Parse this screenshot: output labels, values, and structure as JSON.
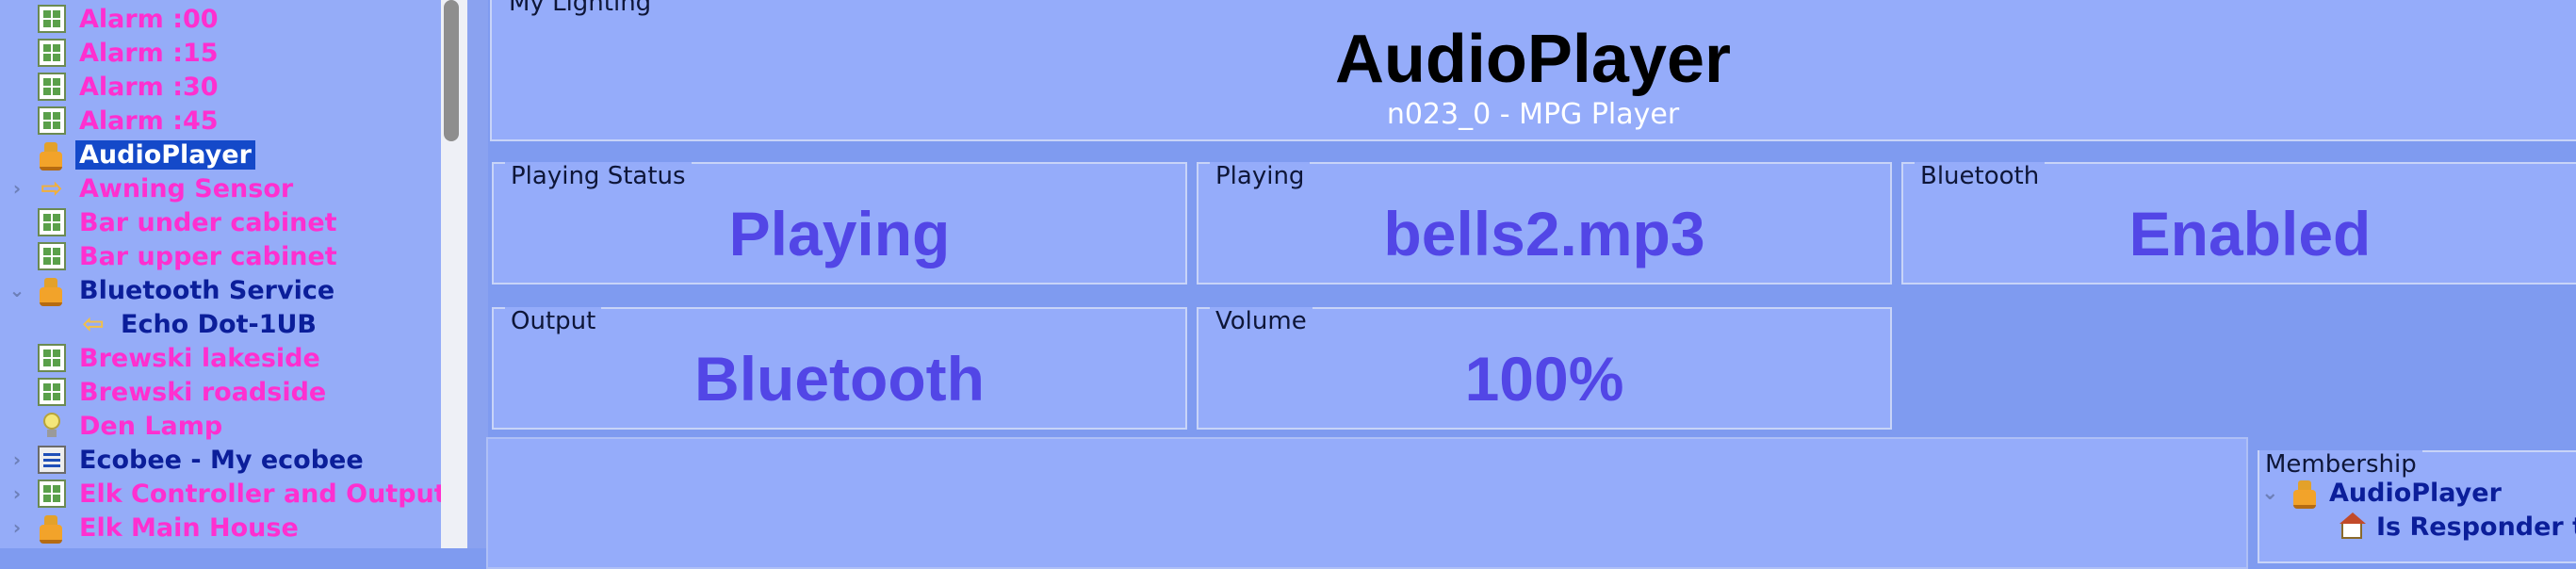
{
  "tree": {
    "items": [
      {
        "label": "Alarm :00",
        "icon": "scene-grid-icon",
        "style": "pink"
      },
      {
        "label": "Alarm :15",
        "icon": "scene-grid-icon",
        "style": "pink"
      },
      {
        "label": "Alarm :30",
        "icon": "scene-grid-icon",
        "style": "pink"
      },
      {
        "label": "Alarm :45",
        "icon": "scene-grid-icon",
        "style": "pink"
      },
      {
        "label": "AudioPlayer",
        "icon": "node-server-icon",
        "style": "selected"
      },
      {
        "label": "Awning Sensor",
        "icon": "arrow-right-icon",
        "style": "pink"
      },
      {
        "label": "Bar under cabinet",
        "icon": "scene-grid-icon",
        "style": "pink"
      },
      {
        "label": "Bar upper cabinet",
        "icon": "scene-grid-icon",
        "style": "pink"
      },
      {
        "label": "Bluetooth Service",
        "icon": "node-server-icon",
        "style": "navy"
      },
      {
        "label": "Echo Dot-1UB",
        "icon": "arrow-left-icon",
        "style": "navy"
      },
      {
        "label": "Brewski lakeside",
        "icon": "scene-grid-icon",
        "style": "pink"
      },
      {
        "label": "Brewski roadside",
        "icon": "scene-grid-icon",
        "style": "pink"
      },
      {
        "label": "Den Lamp",
        "icon": "lightbulb-icon",
        "style": "pink"
      },
      {
        "label": "Ecobee - My ecobee",
        "icon": "thermostat-icon",
        "style": "navy"
      },
      {
        "label": "Elk Controller and Outputs",
        "icon": "scene-grid-icon",
        "style": "pink"
      },
      {
        "label": "Elk Main House",
        "icon": "node-server-icon",
        "style": "pink"
      }
    ]
  },
  "header": {
    "section_label": "My Lighting",
    "title": "AudioPlayer",
    "subtitle": "n023_0 - MPG Player"
  },
  "status": {
    "playing_status": {
      "label": "Playing Status",
      "value": "Playing"
    },
    "playing": {
      "label": "Playing",
      "value": "bells2.mp3"
    },
    "bluetooth": {
      "label": "Bluetooth",
      "value": "Enabled"
    },
    "output": {
      "label": "Output",
      "value": "Bluetooth"
    },
    "volume": {
      "label": "Volume",
      "value": "100%"
    }
  },
  "membership": {
    "label": "Membership",
    "items": [
      {
        "label": "AudioPlayer",
        "icon": "node-server-icon"
      },
      {
        "label": "Is Responder to",
        "icon": "house-icon"
      }
    ]
  },
  "colors": {
    "background": "#7f9bf0",
    "panel": "#95acfa",
    "value_text": "#5246e6",
    "pink_item": "#ff2fd0",
    "navy_item": "#0b1e9a",
    "selection": "#1449c9"
  }
}
